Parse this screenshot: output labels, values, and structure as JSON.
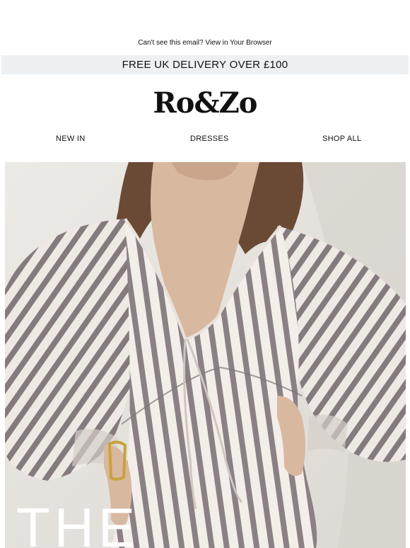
{
  "preheader": {
    "text": "Can't see this email? View in Your Browser"
  },
  "promo_bar": {
    "text": "FREE UK DELIVERY OVER £100",
    "background": "#eef1f4"
  },
  "brand": {
    "logo_text": "Ro&Zo"
  },
  "nav": {
    "items": [
      {
        "label": "NEW IN"
      },
      {
        "label": "DRESSES"
      },
      {
        "label": "SHOP ALL"
      }
    ]
  },
  "hero": {
    "image_subject": "model wearing grey and white striped long-sleeve V-neck dress",
    "overlay_text": "THE",
    "colors": {
      "wall": "#e9e7e2",
      "stripe_dark": "#8a8083",
      "stripe_light": "#f1ece8",
      "hair": "#6b4a35",
      "skin": "#d9b8a0"
    }
  }
}
